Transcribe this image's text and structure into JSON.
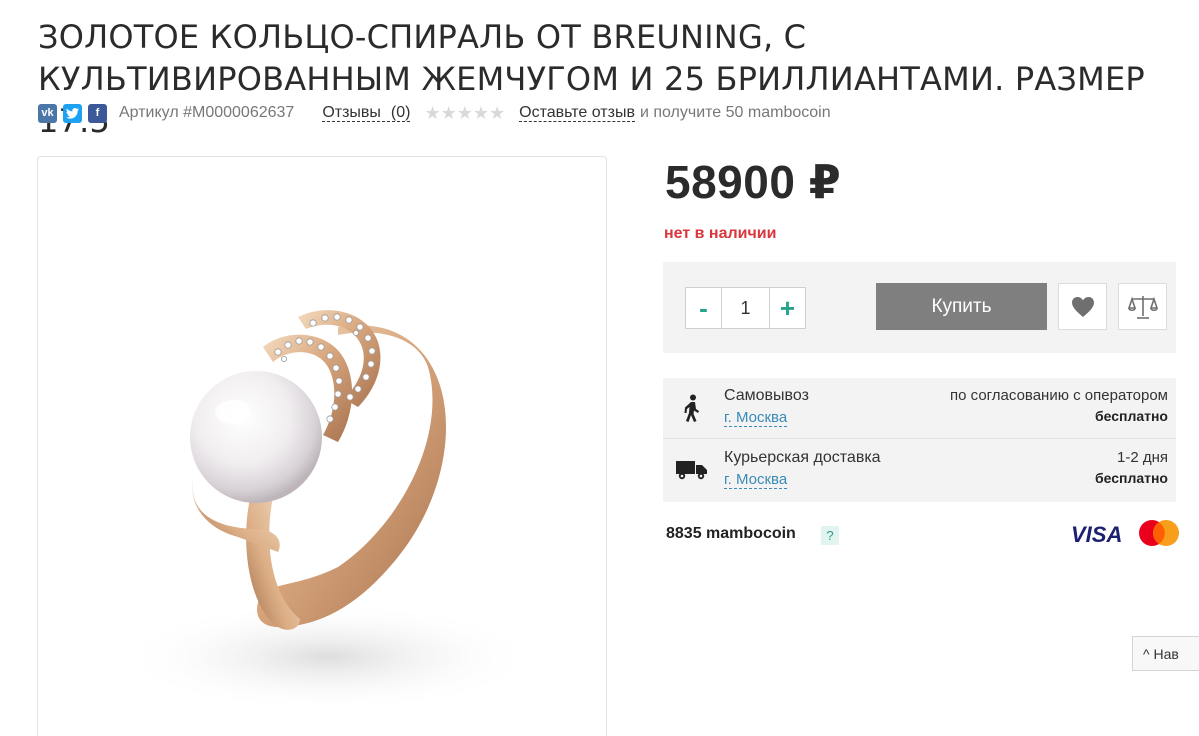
{
  "product": {
    "title": "ЗОЛОТОЕ КОЛЬЦО-СПИРАЛЬ ОТ BREUNING, С КУЛЬТИВИРОВАННЫМ ЖЕМЧУГОМ И 25 БРИЛЛИАНТАМИ. РАЗМЕР 17.5",
    "sku": "Артикул #M0000062637",
    "price": "58900 ₽",
    "stock_status": "нет в наличии"
  },
  "social": {
    "vk": "vk",
    "twitter": "t",
    "facebook": "f"
  },
  "reviews": {
    "label": "Отзывы",
    "count": "(0)",
    "stars": "★★★★★",
    "rating": 0,
    "leave_label": "Оставьте отзыв",
    "bonus_text": "и получите 50 mambocoin"
  },
  "cart": {
    "minus": "-",
    "quantity": "1",
    "plus": "+",
    "buy_label": "Купить"
  },
  "delivery": [
    {
      "icon": "walking-person-icon",
      "name": "Самовывоз",
      "city": "г. Москва",
      "term": "по согласованию с оператором",
      "price": "бесплатно"
    },
    {
      "icon": "truck-icon",
      "name": "Курьерская доставка",
      "city": "г. Москва",
      "term": "1-2 дня",
      "price": "бесплатно"
    }
  ],
  "mambocoin": {
    "text": "8835 mambocoin",
    "help": "?"
  },
  "payment": {
    "visa": "VISA",
    "mastercard": "mastercard-logo"
  },
  "nav_tab": "^ Нав",
  "colors": {
    "accent": "#27a38b",
    "stock_red": "#d9363e",
    "link_blue": "#3a8bb6",
    "buy_button": "#7f7f7f"
  }
}
